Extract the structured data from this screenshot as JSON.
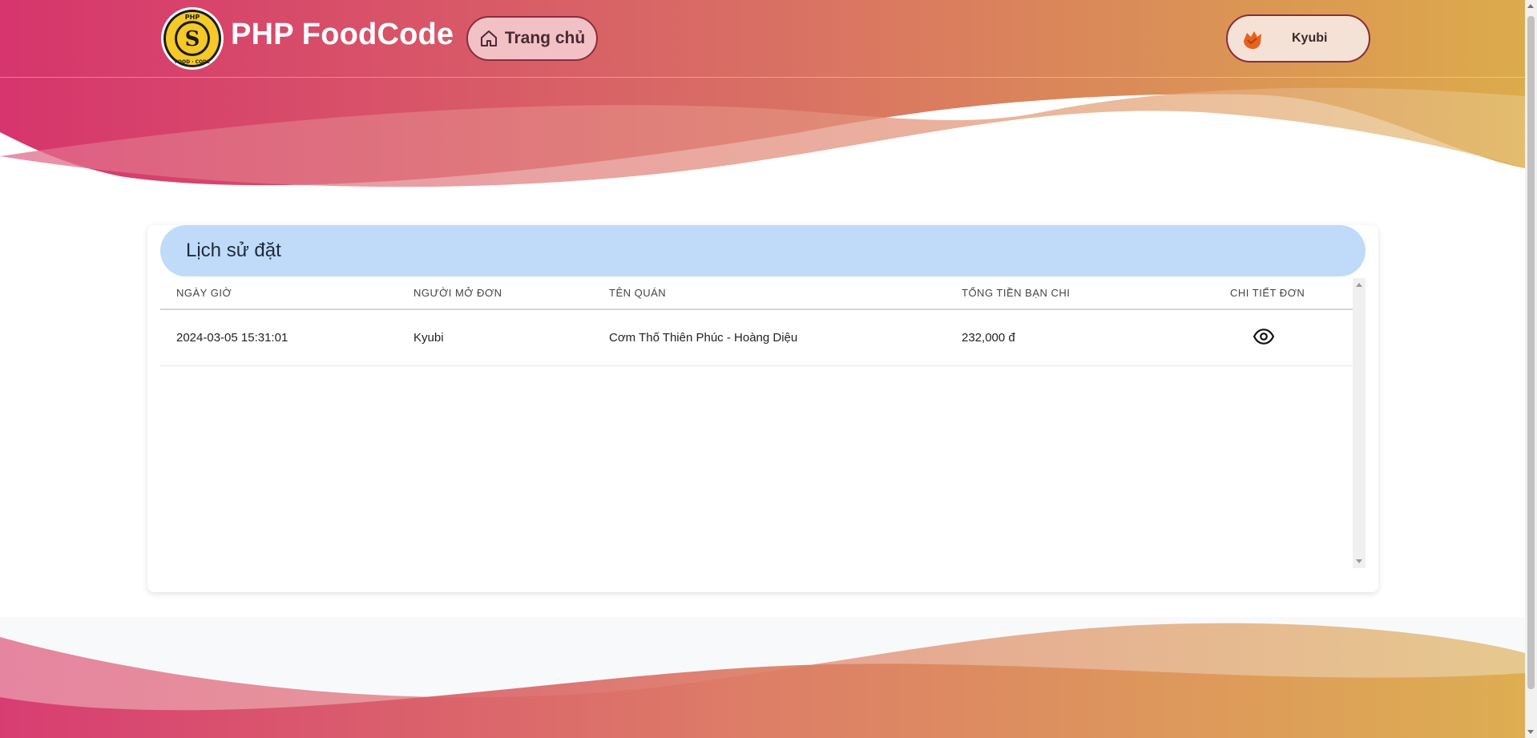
{
  "header": {
    "brand": "PHP FoodCode",
    "home_label": "Trang chủ",
    "user_name": "Kyubi"
  },
  "logo": {
    "top_text": "PHP",
    "bottom_text": "FOOD · CODE"
  },
  "card": {
    "title": "Lịch sử đặt"
  },
  "table": {
    "columns": [
      "NGÀY GIỜ",
      "NGƯỜI MỞ ĐƠN",
      "TÊN QUÁN",
      "TỔNG TIỀN BẠN CHI",
      "CHI TIẾT ĐƠN"
    ],
    "rows": [
      {
        "datetime": "2024-03-05 15:31:01",
        "opener": "Kyubi",
        "restaurant": "Cơm Thố Thiên Phúc - Hoàng Diệu",
        "total": "232,000 đ",
        "detail_icon": "eye-icon"
      }
    ]
  },
  "colors": {
    "gradient_start": "#d63a6e",
    "gradient_end": "#dcaa4c",
    "card_header": "#bfdbf9"
  }
}
